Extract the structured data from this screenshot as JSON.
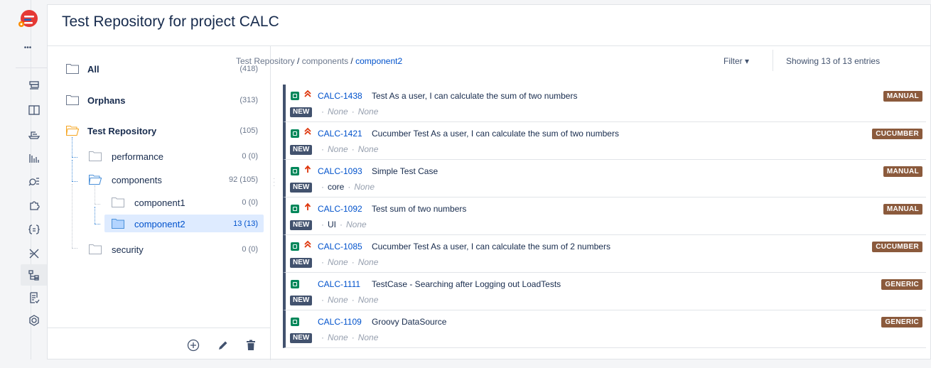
{
  "app": {
    "title": "Test Repository for project CALC",
    "more_label": "•••"
  },
  "rail": {
    "icons": [
      "layers-icon",
      "columns-icon",
      "boat-icon",
      "bar-chart-icon",
      "search-list-icon",
      "puzzle-icon",
      "braces-list-icon",
      "x-tool-icon",
      "tree-structure-icon",
      "checklist-icon",
      "hexagon-settings-icon"
    ],
    "active": "tree-structure-icon"
  },
  "tree": {
    "items": [
      {
        "name": "All",
        "count": "(418)"
      },
      {
        "name": "Orphans",
        "count": "(313)"
      },
      {
        "name": "Test Repository",
        "count": "(105)"
      },
      {
        "name": "performance",
        "count": "0 (0)"
      },
      {
        "name": "components",
        "count": "92 (105)"
      },
      {
        "name": "component1",
        "count": "0 (0)"
      },
      {
        "name": "component2",
        "count": "13 (13)"
      },
      {
        "name": "security",
        "count": "0 (0)"
      }
    ],
    "selected": "component2"
  },
  "breadcrumb": {
    "root": "Test Repository",
    "sep": " / ",
    "middle": "components",
    "current": "component2"
  },
  "filter_label": "Filter ▾",
  "showing": "Showing 13 of 13 entries",
  "tests": [
    {
      "key": "CALC-1438",
      "summary": "Test As a user, I can calculate the sum of two numbers",
      "status": "NEW",
      "meta1": "None",
      "meta2": "None",
      "meta1_italic": true,
      "priority": "highest-icon",
      "prio_glyph": "⌃",
      "type": "MANUAL"
    },
    {
      "key": "CALC-1421",
      "summary": "Cucumber Test As a user, I can calculate the sum of two numbers",
      "status": "NEW",
      "meta1": "None",
      "meta2": "None",
      "meta1_italic": true,
      "priority": "highest-icon",
      "prio_glyph": "⌃",
      "type": "CUCUMBER"
    },
    {
      "key": "CALC-1093",
      "summary": "Simple Test Case",
      "status": "NEW",
      "meta1": "core",
      "meta2": "None",
      "meta1_italic": false,
      "priority": "high-icon",
      "prio_glyph": "↑",
      "type": "MANUAL"
    },
    {
      "key": "CALC-1092",
      "summary": "Test sum of two numbers",
      "status": "NEW",
      "meta1": "UI",
      "meta2": "None",
      "meta1_italic": false,
      "priority": "high-icon",
      "prio_glyph": "↑",
      "type": "MANUAL"
    },
    {
      "key": "CALC-1085",
      "summary": "Cucumber Test As a user, I can calculate the sum of 2 numbers",
      "status": "NEW",
      "meta1": "None",
      "meta2": "None",
      "meta1_italic": true,
      "priority": "highest-icon",
      "prio_glyph": "⌃",
      "type": "CUCUMBER"
    },
    {
      "key": "CALC-1111",
      "summary": "TestCase - Searching after Logging out LoadTests",
      "status": "NEW",
      "meta1": "None",
      "meta2": "None",
      "meta1_italic": true,
      "priority": "",
      "prio_glyph": "",
      "type": "GENERIC"
    },
    {
      "key": "CALC-1109",
      "summary": "Groovy DataSource",
      "status": "NEW",
      "meta1": "None",
      "meta2": "None",
      "meta1_italic": true,
      "priority": "",
      "prio_glyph": "",
      "type": "GENERIC"
    }
  ],
  "colors": {
    "link": "#0052cc",
    "status_green": "#00875a",
    "type_badge": "#8b5a3c",
    "new_badge": "#42526e",
    "selected_bg": "#deebff"
  }
}
